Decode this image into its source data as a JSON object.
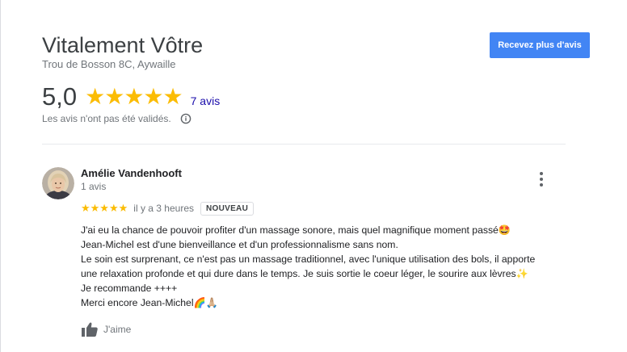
{
  "business": {
    "name": "Vitalement Vôtre",
    "address": "Trou de Bosson 8C, Aywaille"
  },
  "header": {
    "cta_label": "Recevez plus d'avis"
  },
  "summary": {
    "rating_value": "5,0",
    "stars": 5,
    "stars_text": "★★★★★",
    "review_count_label": "7 avis",
    "disclaimer": "Les avis n'ont pas été validés."
  },
  "review": {
    "author": "Amélie Vandenhooft",
    "author_meta": "1 avis",
    "rating": 5,
    "stars_text": "★★★★★",
    "time": "il y a 3 heures",
    "badge": "NOUVEAU",
    "lines": [
      "J'ai eu la chance de pouvoir profiter d'un massage sonore, mais quel magnifique moment passé🤩",
      "Jean-Michel est d'une bienveillance et d'un professionnalisme sans nom.",
      "Le soin est surprenant, ce n'est pas un massage traditionnel, avec l'unique utilisation des bols, il apporte",
      "une relaxation profonde et qui dure dans le temps. Je suis sortie le coeur léger, le sourire aux lèvres✨",
      "Je recommande ++++",
      "Merci encore Jean-Michel🌈🙏🏼"
    ],
    "like_label": "J'aime"
  },
  "colors": {
    "accent_blue": "#4285f4",
    "star_yellow": "#fbbc04",
    "link_blue": "#1a0dab"
  },
  "icons": {
    "info": "info-icon",
    "more": "more-vert-icon",
    "like": "thumb-up-icon"
  }
}
